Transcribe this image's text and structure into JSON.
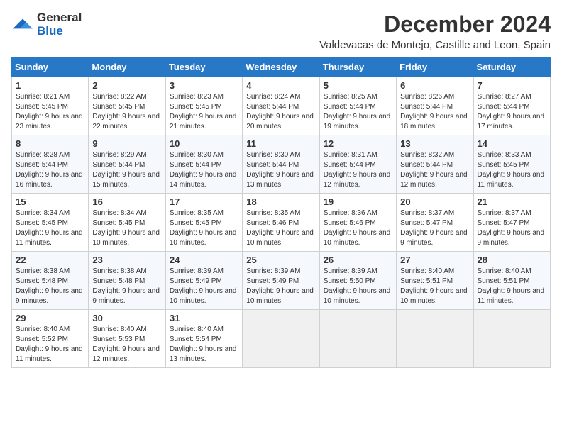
{
  "logo": {
    "general": "General",
    "blue": "Blue"
  },
  "title": "December 2024",
  "subtitle": "Valdevacas de Montejo, Castille and Leon, Spain",
  "columns": [
    "Sunday",
    "Monday",
    "Tuesday",
    "Wednesday",
    "Thursday",
    "Friday",
    "Saturday"
  ],
  "weeks": [
    [
      {
        "day": "1",
        "sunrise": "Sunrise: 8:21 AM",
        "sunset": "Sunset: 5:45 PM",
        "daylight": "Daylight: 9 hours and 23 minutes."
      },
      {
        "day": "2",
        "sunrise": "Sunrise: 8:22 AM",
        "sunset": "Sunset: 5:45 PM",
        "daylight": "Daylight: 9 hours and 22 minutes."
      },
      {
        "day": "3",
        "sunrise": "Sunrise: 8:23 AM",
        "sunset": "Sunset: 5:45 PM",
        "daylight": "Daylight: 9 hours and 21 minutes."
      },
      {
        "day": "4",
        "sunrise": "Sunrise: 8:24 AM",
        "sunset": "Sunset: 5:44 PM",
        "daylight": "Daylight: 9 hours and 20 minutes."
      },
      {
        "day": "5",
        "sunrise": "Sunrise: 8:25 AM",
        "sunset": "Sunset: 5:44 PM",
        "daylight": "Daylight: 9 hours and 19 minutes."
      },
      {
        "day": "6",
        "sunrise": "Sunrise: 8:26 AM",
        "sunset": "Sunset: 5:44 PM",
        "daylight": "Daylight: 9 hours and 18 minutes."
      },
      {
        "day": "7",
        "sunrise": "Sunrise: 8:27 AM",
        "sunset": "Sunset: 5:44 PM",
        "daylight": "Daylight: 9 hours and 17 minutes."
      }
    ],
    [
      {
        "day": "8",
        "sunrise": "Sunrise: 8:28 AM",
        "sunset": "Sunset: 5:44 PM",
        "daylight": "Daylight: 9 hours and 16 minutes."
      },
      {
        "day": "9",
        "sunrise": "Sunrise: 8:29 AM",
        "sunset": "Sunset: 5:44 PM",
        "daylight": "Daylight: 9 hours and 15 minutes."
      },
      {
        "day": "10",
        "sunrise": "Sunrise: 8:30 AM",
        "sunset": "Sunset: 5:44 PM",
        "daylight": "Daylight: 9 hours and 14 minutes."
      },
      {
        "day": "11",
        "sunrise": "Sunrise: 8:30 AM",
        "sunset": "Sunset: 5:44 PM",
        "daylight": "Daylight: 9 hours and 13 minutes."
      },
      {
        "day": "12",
        "sunrise": "Sunrise: 8:31 AM",
        "sunset": "Sunset: 5:44 PM",
        "daylight": "Daylight: 9 hours and 12 minutes."
      },
      {
        "day": "13",
        "sunrise": "Sunrise: 8:32 AM",
        "sunset": "Sunset: 5:44 PM",
        "daylight": "Daylight: 9 hours and 12 minutes."
      },
      {
        "day": "14",
        "sunrise": "Sunrise: 8:33 AM",
        "sunset": "Sunset: 5:45 PM",
        "daylight": "Daylight: 9 hours and 11 minutes."
      }
    ],
    [
      {
        "day": "15",
        "sunrise": "Sunrise: 8:34 AM",
        "sunset": "Sunset: 5:45 PM",
        "daylight": "Daylight: 9 hours and 11 minutes."
      },
      {
        "day": "16",
        "sunrise": "Sunrise: 8:34 AM",
        "sunset": "Sunset: 5:45 PM",
        "daylight": "Daylight: 9 hours and 10 minutes."
      },
      {
        "day": "17",
        "sunrise": "Sunrise: 8:35 AM",
        "sunset": "Sunset: 5:45 PM",
        "daylight": "Daylight: 9 hours and 10 minutes."
      },
      {
        "day": "18",
        "sunrise": "Sunrise: 8:35 AM",
        "sunset": "Sunset: 5:46 PM",
        "daylight": "Daylight: 9 hours and 10 minutes."
      },
      {
        "day": "19",
        "sunrise": "Sunrise: 8:36 AM",
        "sunset": "Sunset: 5:46 PM",
        "daylight": "Daylight: 9 hours and 10 minutes."
      },
      {
        "day": "20",
        "sunrise": "Sunrise: 8:37 AM",
        "sunset": "Sunset: 5:47 PM",
        "daylight": "Daylight: 9 hours and 9 minutes."
      },
      {
        "day": "21",
        "sunrise": "Sunrise: 8:37 AM",
        "sunset": "Sunset: 5:47 PM",
        "daylight": "Daylight: 9 hours and 9 minutes."
      }
    ],
    [
      {
        "day": "22",
        "sunrise": "Sunrise: 8:38 AM",
        "sunset": "Sunset: 5:48 PM",
        "daylight": "Daylight: 9 hours and 9 minutes."
      },
      {
        "day": "23",
        "sunrise": "Sunrise: 8:38 AM",
        "sunset": "Sunset: 5:48 PM",
        "daylight": "Daylight: 9 hours and 9 minutes."
      },
      {
        "day": "24",
        "sunrise": "Sunrise: 8:39 AM",
        "sunset": "Sunset: 5:49 PM",
        "daylight": "Daylight: 9 hours and 10 minutes."
      },
      {
        "day": "25",
        "sunrise": "Sunrise: 8:39 AM",
        "sunset": "Sunset: 5:49 PM",
        "daylight": "Daylight: 9 hours and 10 minutes."
      },
      {
        "day": "26",
        "sunrise": "Sunrise: 8:39 AM",
        "sunset": "Sunset: 5:50 PM",
        "daylight": "Daylight: 9 hours and 10 minutes."
      },
      {
        "day": "27",
        "sunrise": "Sunrise: 8:40 AM",
        "sunset": "Sunset: 5:51 PM",
        "daylight": "Daylight: 9 hours and 10 minutes."
      },
      {
        "day": "28",
        "sunrise": "Sunrise: 8:40 AM",
        "sunset": "Sunset: 5:51 PM",
        "daylight": "Daylight: 9 hours and 11 minutes."
      }
    ],
    [
      {
        "day": "29",
        "sunrise": "Sunrise: 8:40 AM",
        "sunset": "Sunset: 5:52 PM",
        "daylight": "Daylight: 9 hours and 11 minutes."
      },
      {
        "day": "30",
        "sunrise": "Sunrise: 8:40 AM",
        "sunset": "Sunset: 5:53 PM",
        "daylight": "Daylight: 9 hours and 12 minutes."
      },
      {
        "day": "31",
        "sunrise": "Sunrise: 8:40 AM",
        "sunset": "Sunset: 5:54 PM",
        "daylight": "Daylight: 9 hours and 13 minutes."
      },
      null,
      null,
      null,
      null
    ]
  ]
}
